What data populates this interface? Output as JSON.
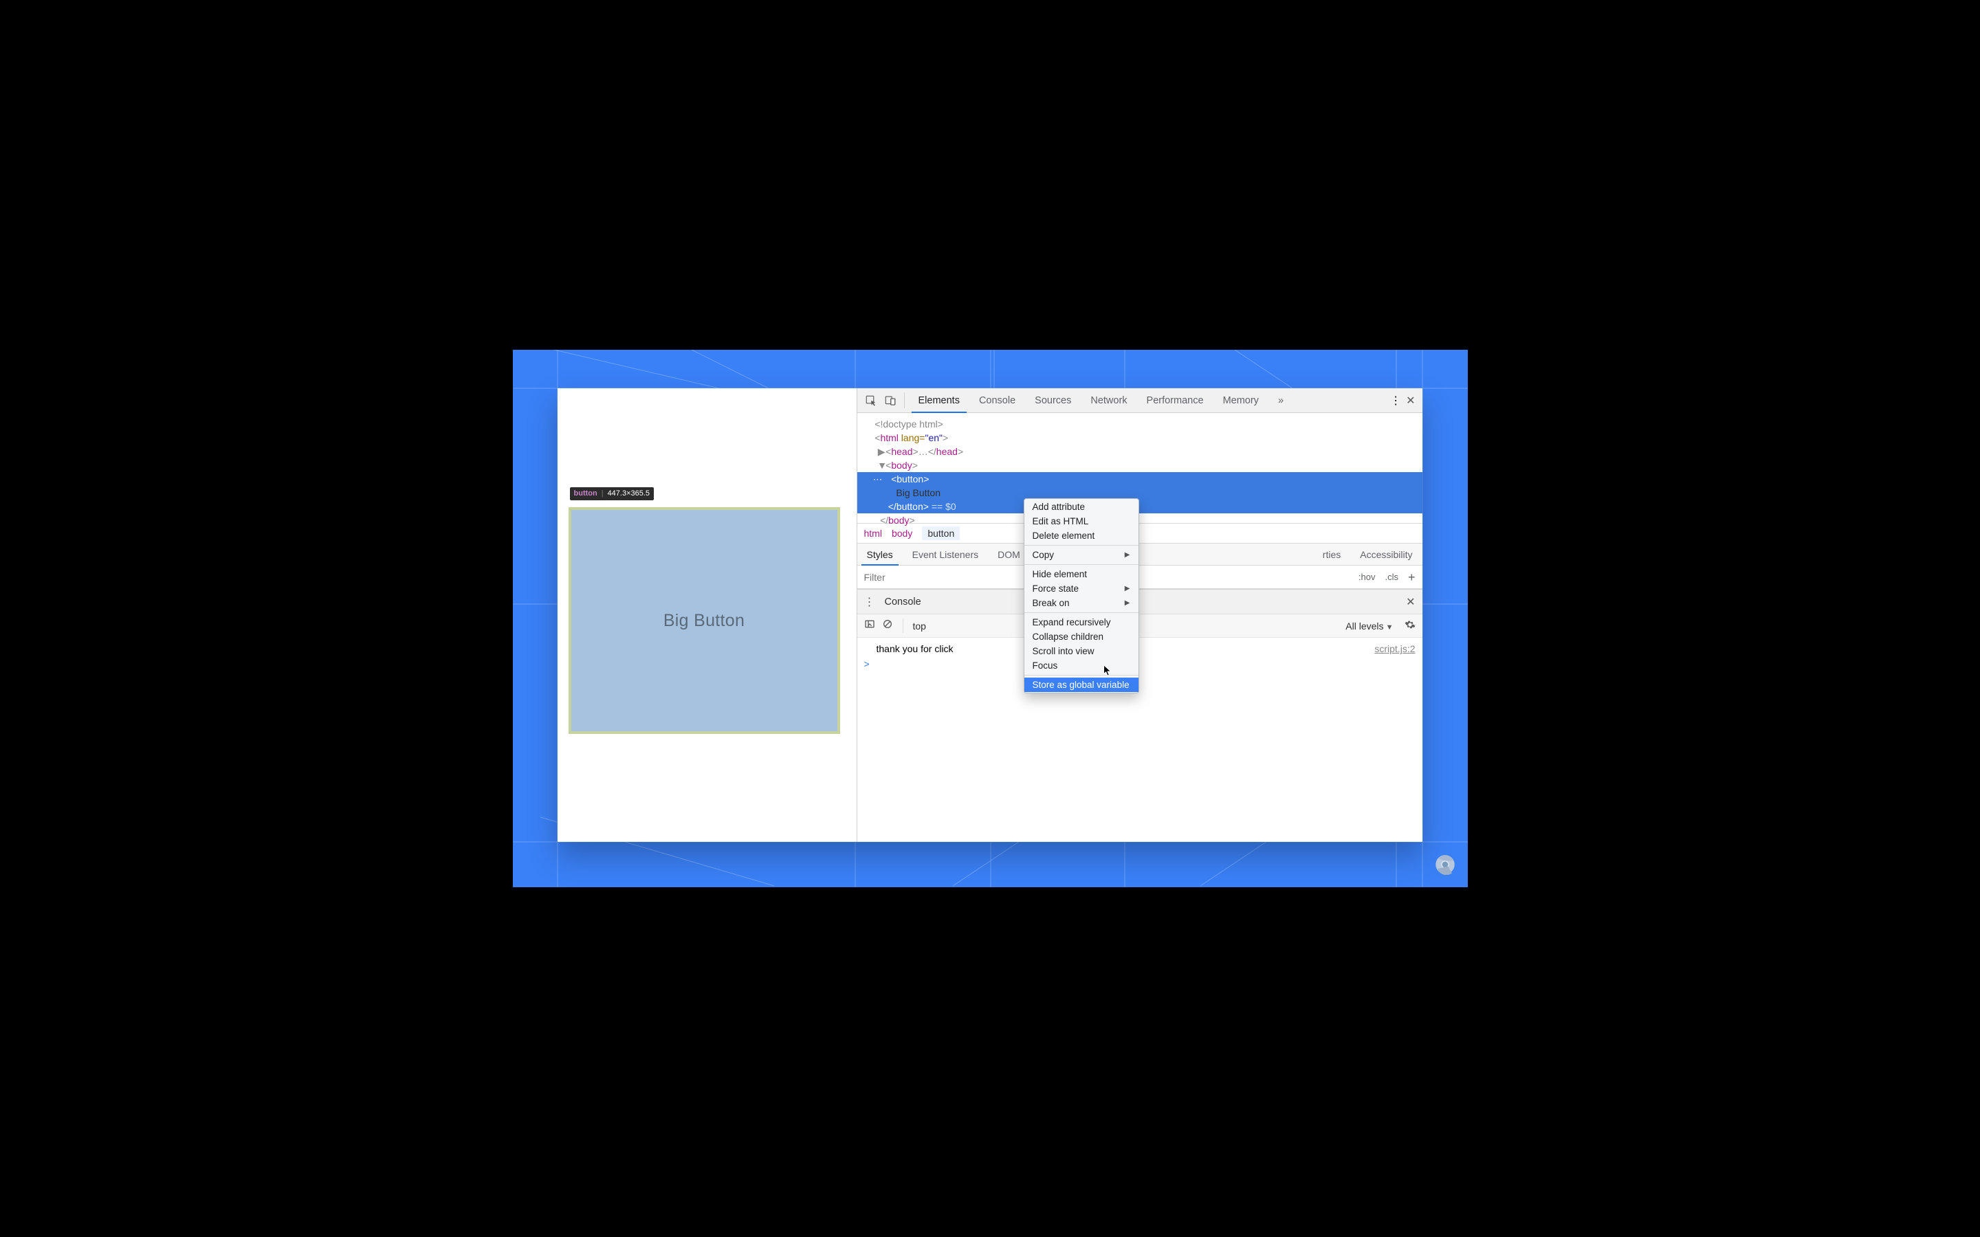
{
  "preview": {
    "tooltip_tag": "button",
    "tooltip_dims": "447.3×365.5",
    "button_label": "Big Button"
  },
  "toolbar": {
    "tabs": [
      "Elements",
      "Console",
      "Sources",
      "Network",
      "Performance",
      "Memory"
    ],
    "active_tab_index": 0
  },
  "dom": {
    "l0": "<!doctype html>",
    "l1_open": "<",
    "l1_tag": "html",
    "l1_attr": " lang=",
    "l1_val": "\"en\"",
    "l1_close": ">",
    "l2_open": "<",
    "l2_tag": "head",
    "l2_close": ">",
    "l2_ell": "…",
    "l2_end_open": "</",
    "l2_end_tag": "head",
    "l2_end_close": ">",
    "l3_open": "<",
    "l3_tag": "body",
    "l3_close": ">",
    "sel_open": "<",
    "sel_tag": "button",
    "sel_close": ">",
    "sel_text": "Big Button",
    "sel_end_open": "</",
    "sel_end_tag": "button",
    "sel_end_close": ">",
    "sel_eq": " == $0",
    "l_end_open": "</",
    "l_end_tag": "body",
    "l_end_close": ">"
  },
  "breadcrumbs": {
    "items": [
      "html",
      "body",
      "button"
    ],
    "selected_index": 2
  },
  "subtabs": {
    "items": [
      "Styles",
      "Event Listeners",
      "DOM Breakpoints",
      "Properties",
      "Accessibility"
    ],
    "active_index": 0,
    "visible_partial_2": "DOM",
    "visible_partial_3": "rties"
  },
  "filter": {
    "placeholder": "Filter",
    "hov": ":hov",
    "cls": ".cls",
    "plus": "+"
  },
  "drawer": {
    "title": "Console",
    "scope": "top",
    "levels": "All levels",
    "log_text": "thank you for click",
    "log_source": "script.js:2",
    "prompt": ">"
  },
  "context_menu": {
    "items": [
      {
        "label": "Add attribute",
        "sub": false
      },
      {
        "label": "Edit as HTML",
        "sub": false
      },
      {
        "label": "Delete element",
        "sub": false
      },
      {
        "sep": true
      },
      {
        "label": "Copy",
        "sub": true
      },
      {
        "sep": true
      },
      {
        "label": "Hide element",
        "sub": false
      },
      {
        "label": "Force state",
        "sub": true
      },
      {
        "label": "Break on",
        "sub": true
      },
      {
        "sep": true
      },
      {
        "label": "Expand recursively",
        "sub": false
      },
      {
        "label": "Collapse children",
        "sub": false
      },
      {
        "label": "Scroll into view",
        "sub": false
      },
      {
        "label": "Focus",
        "sub": false
      },
      {
        "sep": true
      },
      {
        "label": "Store as global variable",
        "sub": false,
        "highlight": true
      }
    ]
  }
}
